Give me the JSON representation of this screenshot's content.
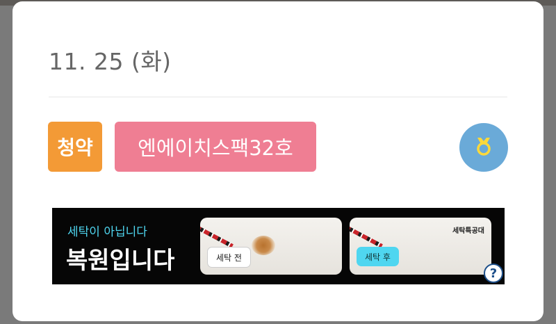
{
  "schedule": {
    "date": "11. 25 (화)",
    "tags": [
      {
        "label": "청약",
        "color": "#f39a36"
      },
      {
        "label": "엔에이치스팩32호",
        "color": "#ef7e93"
      }
    ],
    "award_icon": "award-ribbon-icon",
    "award_color": "#6aaad8"
  },
  "ad": {
    "line1": "세탁이 아닙니다",
    "line2": "복원입니다",
    "before_label": "세탁 전",
    "after_label": "세탁 후",
    "brand": "세탁특공대",
    "help_icon": "question-icon",
    "help_text": "?"
  }
}
